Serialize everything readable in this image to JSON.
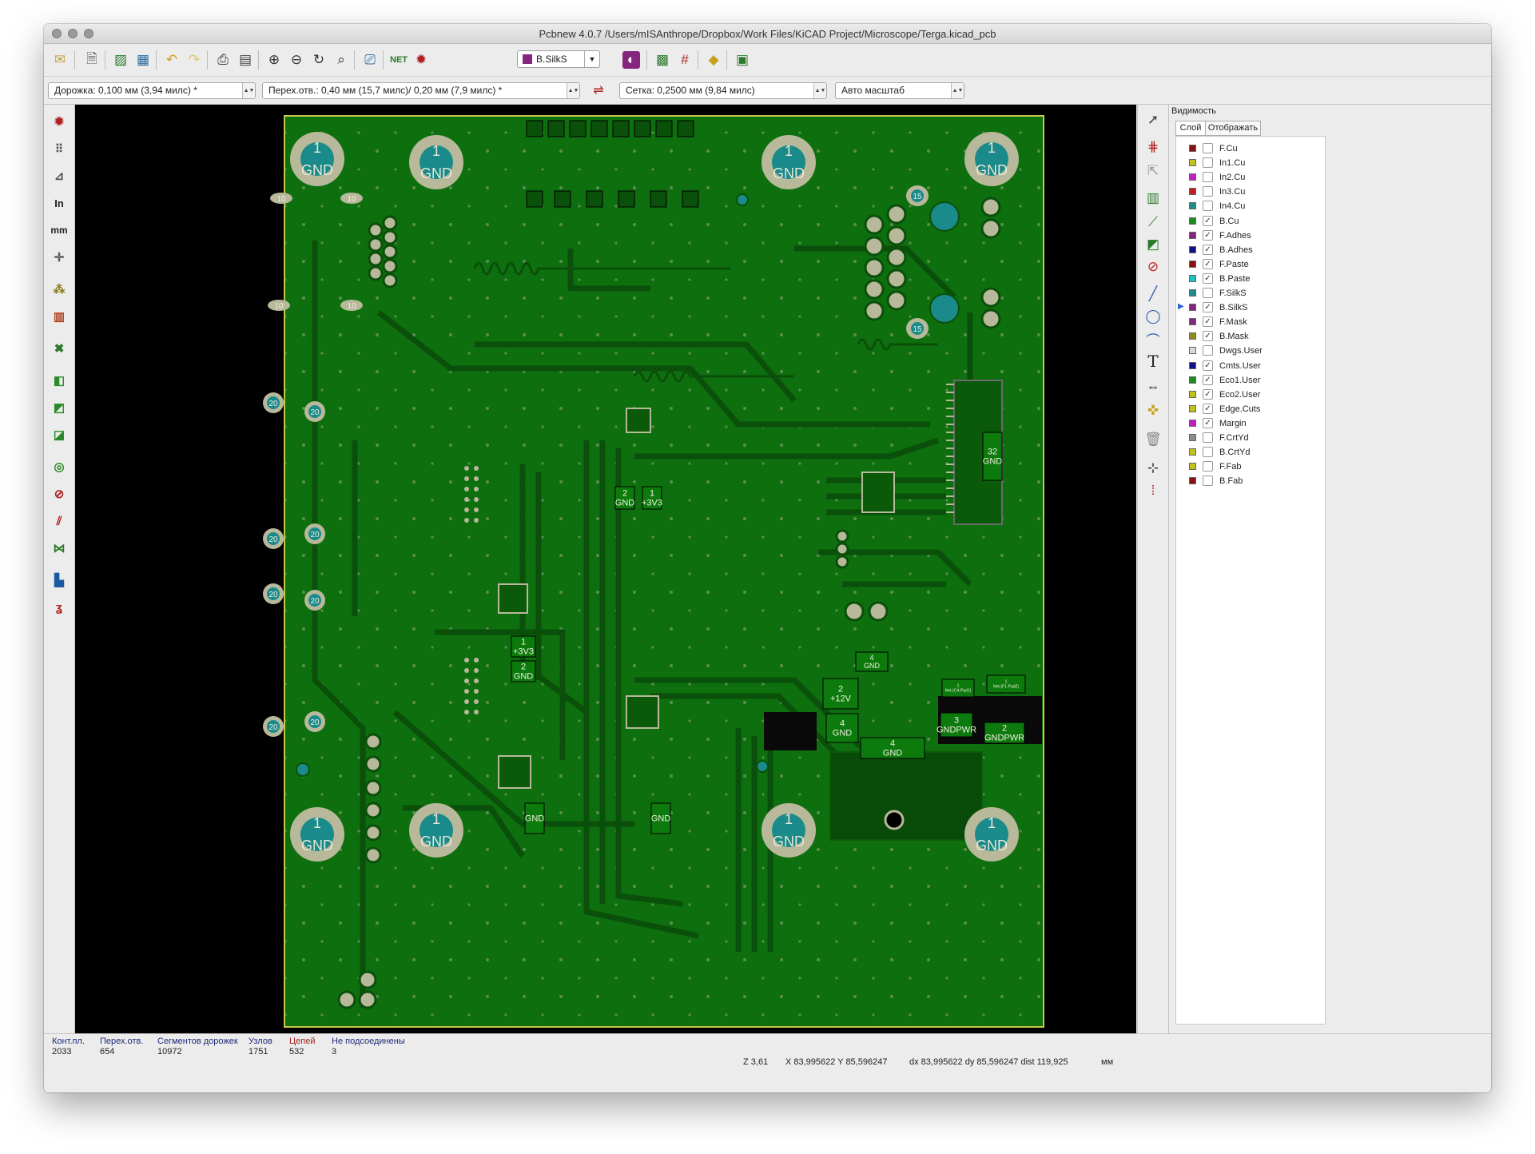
{
  "window": {
    "title": "Pcbnew 4.0.7 /Users/mISAnthrope/Dropbox/Work Files/KiCAD Project/Microscope/Terga.kicad_pcb"
  },
  "toolbar": {
    "active_layer": "B.SilkS",
    "active_layer_color": "#84267e",
    "track_width": "Дорожка: 0,100 мм (3,94 милс) *",
    "via_size": "Перех.отв.: 0,40 мм (15,7 милс)/ 0,20 мм (7,9 милс) *",
    "grid": "Сетка: 0,2500 мм (9,84 милс)",
    "zoom": "Авто масштаб"
  },
  "left_tools": {
    "inch_label": "In",
    "mm_label": "mm"
  },
  "right_tools": {
    "text_tool_glyph": "T"
  },
  "panel": {
    "title": "Видимость",
    "tab_layers": "Слой",
    "tab_render": "Отображать",
    "layers": [
      {
        "name": "F.Cu",
        "color": "#8b1010",
        "visible": false
      },
      {
        "name": "In1.Cu",
        "color": "#c2c21c",
        "visible": false
      },
      {
        "name": "In2.Cu",
        "color": "#c21cc2",
        "visible": false
      },
      {
        "name": "In3.Cu",
        "color": "#c21c1c",
        "visible": false
      },
      {
        "name": "In4.Cu",
        "color": "#1c8c8c",
        "visible": false
      },
      {
        "name": "B.Cu",
        "color": "#1c8c1c",
        "visible": true
      },
      {
        "name": "F.Adhes",
        "color": "#84267e",
        "visible": true
      },
      {
        "name": "B.Adhes",
        "color": "#10108b",
        "visible": true
      },
      {
        "name": "F.Paste",
        "color": "#8b1010",
        "visible": true
      },
      {
        "name": "B.Paste",
        "color": "#1cc2c2",
        "visible": true
      },
      {
        "name": "F.SilkS",
        "color": "#1c8c8c",
        "visible": false
      },
      {
        "name": "B.SilkS",
        "color": "#84267e",
        "visible": true,
        "active": true
      },
      {
        "name": "F.Mask",
        "color": "#84267e",
        "visible": true
      },
      {
        "name": "B.Mask",
        "color": "#8c8c1c",
        "visible": true
      },
      {
        "name": "Dwgs.User",
        "color": "#d8d8d8",
        "visible": false
      },
      {
        "name": "Cmts.User",
        "color": "#10108b",
        "visible": true
      },
      {
        "name": "Eco1.User",
        "color": "#1c8c1c",
        "visible": true
      },
      {
        "name": "Eco2.User",
        "color": "#c2c21c",
        "visible": true
      },
      {
        "name": "Edge.Cuts",
        "color": "#c2c21c",
        "visible": true
      },
      {
        "name": "Margin",
        "color": "#c21cc2",
        "visible": true
      },
      {
        "name": "F.CrtYd",
        "color": "#8c8c8c",
        "visible": false
      },
      {
        "name": "B.CrtYd",
        "color": "#c2c21c",
        "visible": false
      },
      {
        "name": "F.Fab",
        "color": "#c2c21c",
        "visible": false
      },
      {
        "name": "B.Fab",
        "color": "#8b1010",
        "visible": false
      }
    ]
  },
  "status": {
    "pads_label": "Конт.пл.",
    "pads_value": "2033",
    "vias_label": "Перех.отв.",
    "vias_value": "654",
    "tracks_label": "Сегментов дорожек",
    "tracks_value": "10972",
    "nodes_label": "Узлов",
    "nodes_value": "1751",
    "nets_label": "Цепей",
    "nets_value": "532",
    "unrouted_label": "Не подсоединены",
    "unrouted_value": "3",
    "zoom_readout": "Z 3,61",
    "xy_readout": "X 83,995622  Y 85,596247",
    "dxdy_readout": "dx 83,995622  dy 85,596247  dist 119,925",
    "units": "мм"
  },
  "board": {
    "mount_hole_number": "1",
    "mount_hole_net": "GND",
    "pad_labels": [
      "10",
      "10",
      "10",
      "10",
      "15",
      "15",
      "20",
      "20",
      "20",
      "20",
      "20",
      "20",
      "20",
      "20"
    ],
    "net_labels": [
      "2\n+12V",
      "4\nGND",
      "4\nGND",
      "4\nGND",
      "3\nGNDPWR",
      "2\nGNDPWR",
      "1\n+3V3",
      "2\nGND",
      "GND",
      "GND",
      "2\nGND",
      "1\n+3V3",
      "32\nGND",
      "1\nNet-(C4-Pad1)",
      "1\nNet-(F1-Pad2)"
    ],
    "colors": {
      "copper": "#0e6f0e",
      "trace": "#0b5a0b",
      "outline": "#c8c84a",
      "pad": "#b8b89a",
      "hole": "#1a8a8a"
    }
  }
}
